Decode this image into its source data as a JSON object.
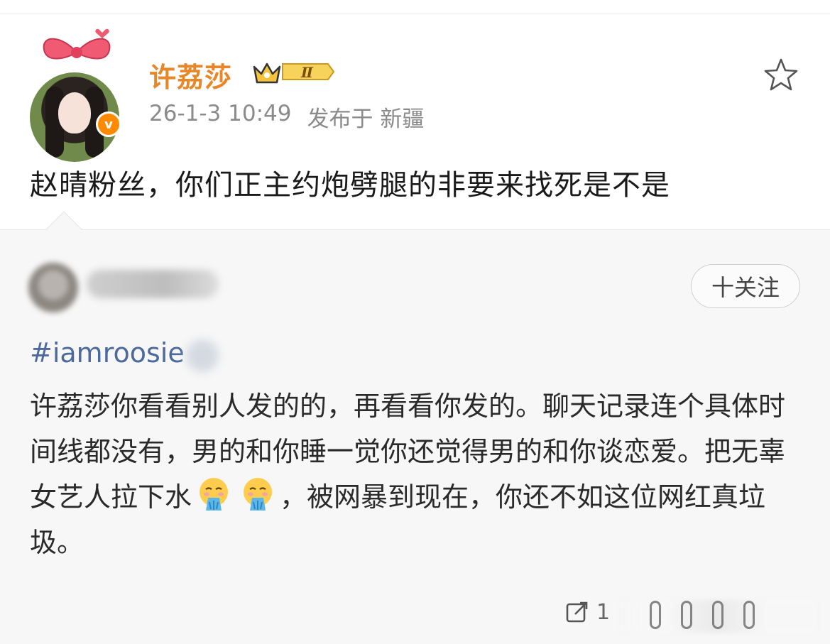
{
  "post": {
    "username": "许荔莎",
    "vip_level": "Ⅱ",
    "timestamp": "26-1-3 10:49",
    "location": "发布于 新疆",
    "text": "赵晴粉丝，你们正主约炮劈腿的非要来找死是不是"
  },
  "repost": {
    "follow_label": "十关注",
    "hashtag": "#iamroosie",
    "text_part1": "许荔莎你看看别人发的的，再看看你发的。聊天记录连个具体时间线都没有，男的和你睡一觉你还觉得男的和你谈恋爱。把无辜女艺人拉下水",
    "text_part2": "，被网暴到现在，你还不如这位网红真垃圾。",
    "emoji_name": "vomiting-face-emoji",
    "repost_count": "1"
  },
  "colors": {
    "username": "#e8862a",
    "verified": "#ff8a00",
    "hashtag": "#4d6a9c",
    "repost_bg": "#f7f7f7"
  }
}
